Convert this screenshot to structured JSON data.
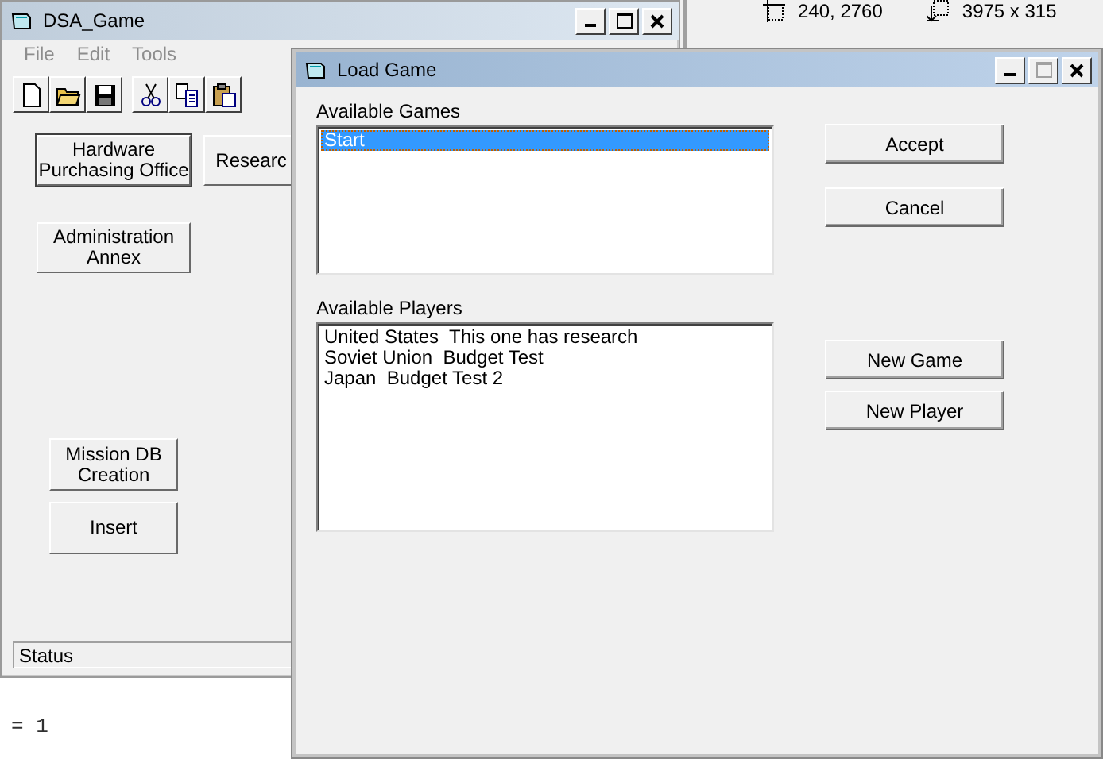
{
  "background_window": {
    "position_text": "240, 2760",
    "size_text": "3975 x 315"
  },
  "code_editor": {
    "lines": [
      "= 1"
    ]
  },
  "main_window": {
    "title": "DSA_Game",
    "menu": [
      {
        "label": "File",
        "disabled": true
      },
      {
        "label": "Edit",
        "disabled": true
      },
      {
        "label": "Tools",
        "disabled": true
      }
    ],
    "buttons": [
      {
        "label": "Hardware\nPurchasing Office",
        "focused": true
      },
      {
        "label": "Researc",
        "focused": false
      },
      {
        "label": "Administration\nAnnex",
        "focused": false
      },
      {
        "label": "Mission DB\nCreation",
        "focused": false
      },
      {
        "label": "Insert",
        "focused": false
      }
    ],
    "status_bar": "Status"
  },
  "dialog": {
    "title": "Load Game",
    "games_label": "Available Games",
    "games": [
      {
        "label": "Start",
        "selected": true
      }
    ],
    "players_label": "Available Players",
    "players": [
      {
        "label": "United States  This one has research",
        "selected": false
      },
      {
        "label": "Soviet Union  Budget Test",
        "selected": false
      },
      {
        "label": "Japan  Budget Test 2",
        "selected": false
      }
    ],
    "top_buttons": [
      "Accept",
      "Cancel"
    ],
    "bottom_buttons": [
      "New Game",
      "New Player"
    ]
  }
}
